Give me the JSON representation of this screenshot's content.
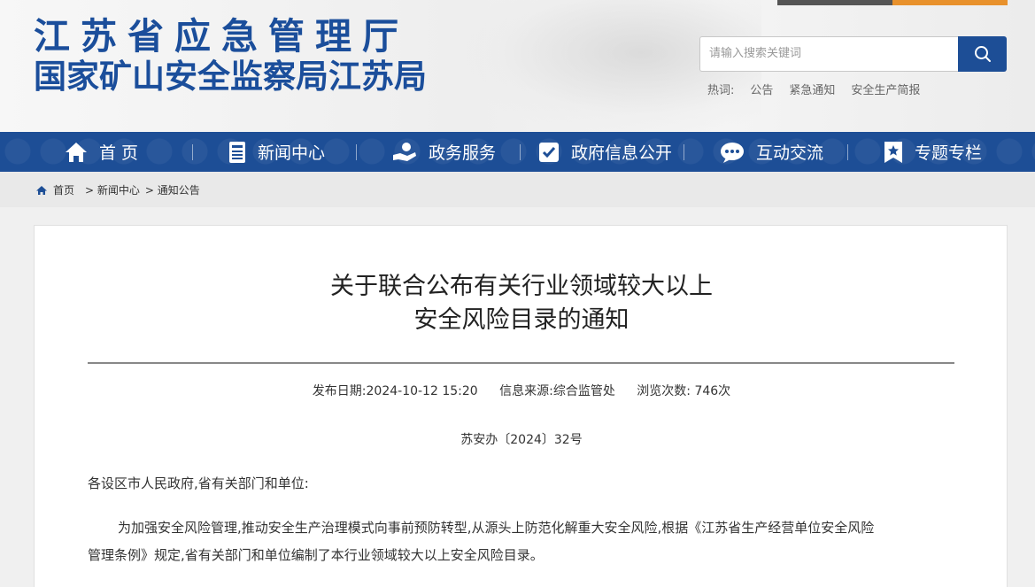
{
  "header": {
    "title_line1": "江苏省应急管理厅",
    "title_line2": "国家矿山安全监察局江苏局",
    "search_placeholder": "请输入搜索关键词",
    "hot_label": "热词:",
    "hot_words": [
      "公告",
      "紧急通知",
      "安全生产简报"
    ]
  },
  "nav": {
    "items": [
      {
        "label": "首 页",
        "icon": "home-icon"
      },
      {
        "label": "新闻中心",
        "icon": "news-icon"
      },
      {
        "label": "政务服务",
        "icon": "service-icon"
      },
      {
        "label": "政府信息公开",
        "icon": "info-open-icon"
      },
      {
        "label": "互动交流",
        "icon": "chat-icon"
      },
      {
        "label": "专题专栏",
        "icon": "bookmark-icon"
      }
    ]
  },
  "breadcrumb": {
    "home": "首页",
    "level1": "> 新闻中心",
    "level2": "> 通知公告"
  },
  "article": {
    "title_line1": "关于联合公布有关行业领域较大以上",
    "title_line2": "安全风险目录的通知",
    "publish_date": "发布日期:2024-10-12 15:20",
    "source": "信息来源:综合监管处",
    "views": "浏览次数: 746次",
    "doc_no": "苏安办〔2024〕32号",
    "salutation": "各设区市人民政府,省有关部门和单位:",
    "body_line1": "为加强安全风险管理,推动安全生产治理模式向事前预防转型,从源头上防范化解重大安全风险,根据《江苏省生产经营单位安全风险",
    "body_line2": "管理条例》规定,省有关部门和单位编制了本行业领域较大以上安全风险目录。"
  },
  "colors": {
    "brand_blue": "#1d4e96",
    "accent_orange": "#e8912c"
  }
}
